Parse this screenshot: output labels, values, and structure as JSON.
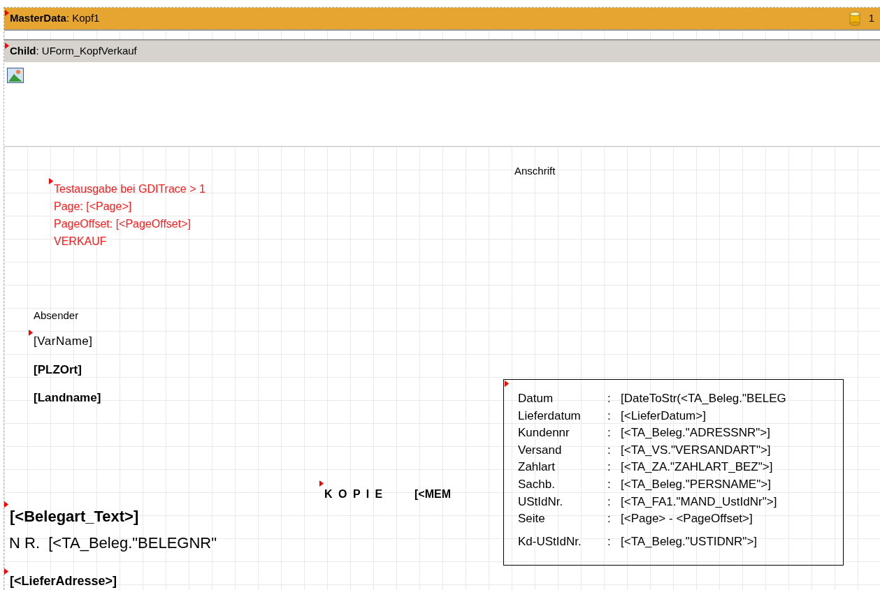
{
  "master_band": {
    "kind": "MasterData",
    "separator": ":",
    "name": "Kopf1",
    "count": "1"
  },
  "child_band": {
    "kind": "Child",
    "separator": ":",
    "name": "UForm_KopfVerkauf"
  },
  "trace_text": {
    "lines": [
      "Testausgabe bei GDITrace > 1",
      "Page: [<Page>]",
      "PageOffset: [<PageOffset>]",
      "VERKAUF"
    ]
  },
  "address_label": "Anschrift",
  "sender_label": "Absender",
  "var_name": "[VarName]",
  "plz_ort": "[PLZOrt]",
  "landname": "[Landname]",
  "kopie": {
    "word": "K O P I E",
    "memo": "[<MEM"
  },
  "belegart": "[<Belegart_Text>]",
  "beleg_nr": "N R.  [<TA_Beleg.\"BELEGNR\"",
  "liefer_adresse": "[<LieferAdresse>]",
  "info_rows": [
    {
      "label": "Datum",
      "separator": ":",
      "value": "[DateToStr(<TA_Beleg.\"BELEG"
    },
    {
      "label": "Lieferdatum",
      "separator": ":",
      "value": "[<LieferDatum>]"
    },
    {
      "label": "Kundennr",
      "separator": ":",
      "value": "[<TA_Beleg.\"ADRESSNR\">]"
    },
    {
      "label": "Versand",
      "separator": ":",
      "value": "[<TA_VS.\"VERSANDART\">]"
    },
    {
      "label": "Zahlart",
      "separator": ":",
      "value": "[<TA_ZA.\"ZAHLART_BEZ\">]"
    },
    {
      "label": "Sachb.",
      "separator": ":",
      "value": "[<TA_Beleg.\"PERSNAME\">]"
    },
    {
      "label": "UStIdNr.",
      "separator": ":",
      "value": "[<TA_FA1.\"MAND_UstIdNr\">]"
    },
    {
      "label": "Seite",
      "separator": ":",
      "value": "[<Page>  - <PageOffset>]"
    },
    {
      "label": "Kd-UStIdNr.",
      "separator": ":",
      "value": "[<TA_Beleg.\"USTIDNR\">]"
    }
  ]
}
